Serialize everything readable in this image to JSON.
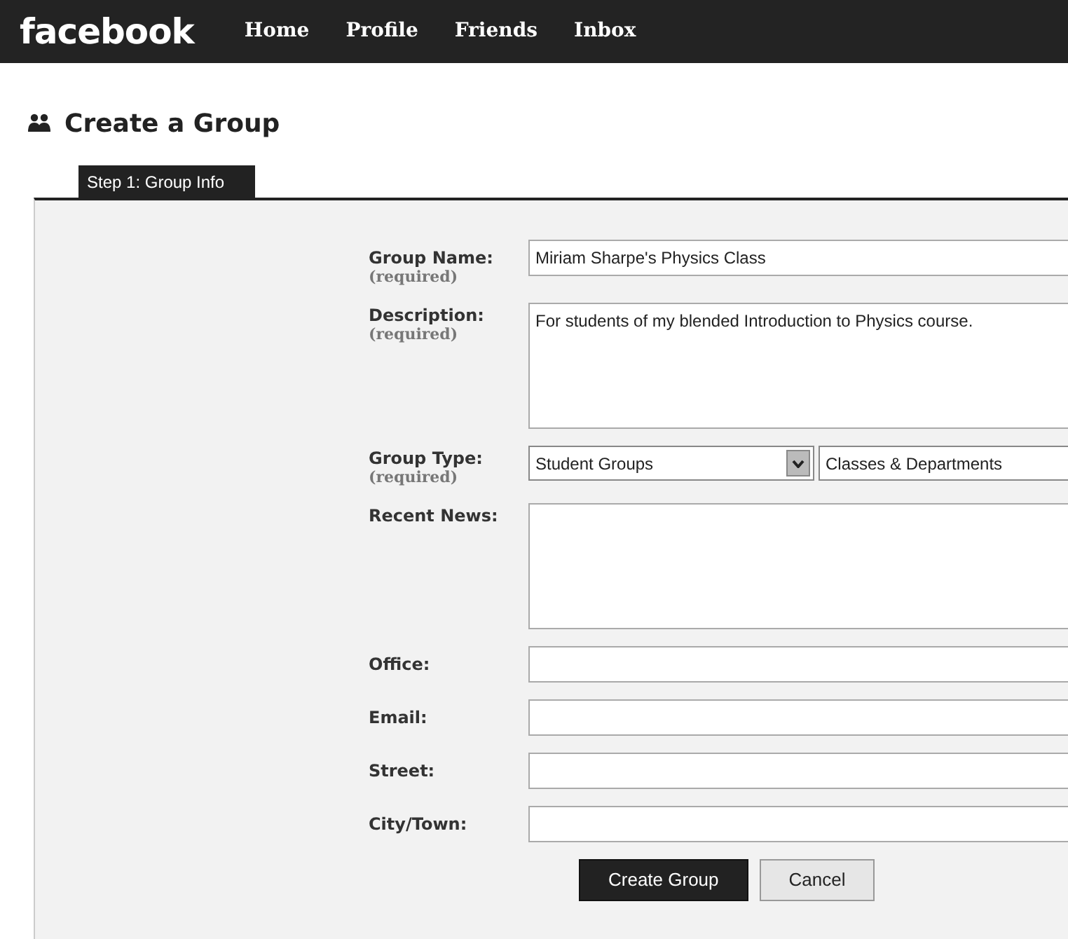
{
  "top_bar": {
    "logo": "facebook",
    "nav": [
      "Home",
      "Profile",
      "Friends",
      "Inbox"
    ]
  },
  "heading": "Create a Group",
  "tabs": [
    {
      "label": "Step 1: Group Info",
      "selected": true
    }
  ],
  "form": {
    "fields": [
      {
        "kind": "text",
        "label": "Group Name:",
        "hint": "(required)",
        "value": "Miriam Sharpe's Physics Class"
      },
      {
        "kind": "textarea",
        "label": "Description:",
        "hint": "(required)",
        "value": "For students of my blended Introduction to Physics course."
      },
      {
        "kind": "selects",
        "label": "Group Type:",
        "hint": "(required)",
        "selects": [
          {
            "value": "Student Groups"
          },
          {
            "value": "Classes & Departments"
          }
        ]
      },
      {
        "kind": "textarea",
        "label": "Recent News:"
      },
      {
        "kind": "text",
        "label": "Office:"
      },
      {
        "kind": "text",
        "label": "Email:"
      },
      {
        "kind": "text",
        "label": "Street:"
      },
      {
        "kind": "text",
        "label": "City/Town:"
      }
    ],
    "buttons": [
      {
        "label": "Create Group",
        "kind": "primary"
      },
      {
        "label": "Cancel",
        "kind": "secondary"
      }
    ]
  }
}
